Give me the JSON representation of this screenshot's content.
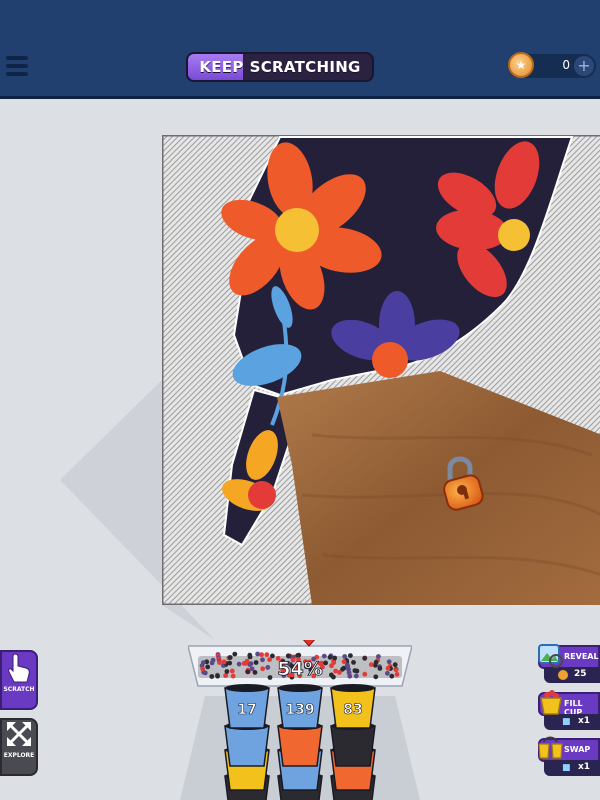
{
  "header": {
    "status_word1": "KEEP",
    "status_word2": "SCRATCHING",
    "status_progress": 0.3,
    "coins": "0"
  },
  "collector": {
    "percent_label": "54%"
  },
  "cups": {
    "front_row": [
      {
        "count": "17",
        "color": "#6fa3e0"
      },
      {
        "count": "139",
        "color": "#6fa3e0"
      },
      {
        "count": "83",
        "color": "#f2c11c"
      }
    ],
    "back_rows": [
      [
        "#6fa3e0",
        "#f0672f",
        "#2a2a30"
      ],
      [
        "#f2c11c",
        "#6fa3e0",
        "#f0672f"
      ],
      [
        "#2a2a30",
        "#2a2a30",
        "#2a2a30"
      ]
    ]
  },
  "tools": {
    "scratch_label": "SCRATCH",
    "explore_label": "EXPLORE"
  },
  "boosters": {
    "reveal_label": "REVEAL",
    "reveal_cost": "25",
    "fill_label": "FILL CUP",
    "fill_count": "x1",
    "swap_label": "SWAP",
    "swap_count": "x1"
  },
  "icons": {
    "menu": "hamburger-icon",
    "coin": "coin-icon",
    "lock": "padlock-icon",
    "gem": "ruby-gem-icon"
  },
  "colors": {
    "topbar": "#21406f",
    "accent_purple": "#6a3ac2",
    "background": "#dcdfe4"
  }
}
